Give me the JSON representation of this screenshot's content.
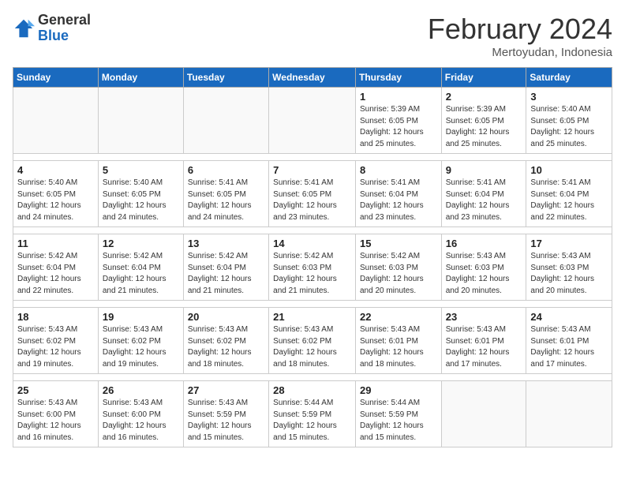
{
  "logo": {
    "general": "General",
    "blue": "Blue"
  },
  "title": "February 2024",
  "subtitle": "Mertoyudan, Indonesia",
  "weekdays": [
    "Sunday",
    "Monday",
    "Tuesday",
    "Wednesday",
    "Thursday",
    "Friday",
    "Saturday"
  ],
  "weeks": [
    [
      {
        "day": "",
        "detail": ""
      },
      {
        "day": "",
        "detail": ""
      },
      {
        "day": "",
        "detail": ""
      },
      {
        "day": "",
        "detail": ""
      },
      {
        "day": "1",
        "detail": "Sunrise: 5:39 AM\nSunset: 6:05 PM\nDaylight: 12 hours\nand 25 minutes."
      },
      {
        "day": "2",
        "detail": "Sunrise: 5:39 AM\nSunset: 6:05 PM\nDaylight: 12 hours\nand 25 minutes."
      },
      {
        "day": "3",
        "detail": "Sunrise: 5:40 AM\nSunset: 6:05 PM\nDaylight: 12 hours\nand 25 minutes."
      }
    ],
    [
      {
        "day": "4",
        "detail": "Sunrise: 5:40 AM\nSunset: 6:05 PM\nDaylight: 12 hours\nand 24 minutes."
      },
      {
        "day": "5",
        "detail": "Sunrise: 5:40 AM\nSunset: 6:05 PM\nDaylight: 12 hours\nand 24 minutes."
      },
      {
        "day": "6",
        "detail": "Sunrise: 5:41 AM\nSunset: 6:05 PM\nDaylight: 12 hours\nand 24 minutes."
      },
      {
        "day": "7",
        "detail": "Sunrise: 5:41 AM\nSunset: 6:05 PM\nDaylight: 12 hours\nand 23 minutes."
      },
      {
        "day": "8",
        "detail": "Sunrise: 5:41 AM\nSunset: 6:04 PM\nDaylight: 12 hours\nand 23 minutes."
      },
      {
        "day": "9",
        "detail": "Sunrise: 5:41 AM\nSunset: 6:04 PM\nDaylight: 12 hours\nand 23 minutes."
      },
      {
        "day": "10",
        "detail": "Sunrise: 5:41 AM\nSunset: 6:04 PM\nDaylight: 12 hours\nand 22 minutes."
      }
    ],
    [
      {
        "day": "11",
        "detail": "Sunrise: 5:42 AM\nSunset: 6:04 PM\nDaylight: 12 hours\nand 22 minutes."
      },
      {
        "day": "12",
        "detail": "Sunrise: 5:42 AM\nSunset: 6:04 PM\nDaylight: 12 hours\nand 21 minutes."
      },
      {
        "day": "13",
        "detail": "Sunrise: 5:42 AM\nSunset: 6:04 PM\nDaylight: 12 hours\nand 21 minutes."
      },
      {
        "day": "14",
        "detail": "Sunrise: 5:42 AM\nSunset: 6:03 PM\nDaylight: 12 hours\nand 21 minutes."
      },
      {
        "day": "15",
        "detail": "Sunrise: 5:42 AM\nSunset: 6:03 PM\nDaylight: 12 hours\nand 20 minutes."
      },
      {
        "day": "16",
        "detail": "Sunrise: 5:43 AM\nSunset: 6:03 PM\nDaylight: 12 hours\nand 20 minutes."
      },
      {
        "day": "17",
        "detail": "Sunrise: 5:43 AM\nSunset: 6:03 PM\nDaylight: 12 hours\nand 20 minutes."
      }
    ],
    [
      {
        "day": "18",
        "detail": "Sunrise: 5:43 AM\nSunset: 6:02 PM\nDaylight: 12 hours\nand 19 minutes."
      },
      {
        "day": "19",
        "detail": "Sunrise: 5:43 AM\nSunset: 6:02 PM\nDaylight: 12 hours\nand 19 minutes."
      },
      {
        "day": "20",
        "detail": "Sunrise: 5:43 AM\nSunset: 6:02 PM\nDaylight: 12 hours\nand 18 minutes."
      },
      {
        "day": "21",
        "detail": "Sunrise: 5:43 AM\nSunset: 6:02 PM\nDaylight: 12 hours\nand 18 minutes."
      },
      {
        "day": "22",
        "detail": "Sunrise: 5:43 AM\nSunset: 6:01 PM\nDaylight: 12 hours\nand 18 minutes."
      },
      {
        "day": "23",
        "detail": "Sunrise: 5:43 AM\nSunset: 6:01 PM\nDaylight: 12 hours\nand 17 minutes."
      },
      {
        "day": "24",
        "detail": "Sunrise: 5:43 AM\nSunset: 6:01 PM\nDaylight: 12 hours\nand 17 minutes."
      }
    ],
    [
      {
        "day": "25",
        "detail": "Sunrise: 5:43 AM\nSunset: 6:00 PM\nDaylight: 12 hours\nand 16 minutes."
      },
      {
        "day": "26",
        "detail": "Sunrise: 5:43 AM\nSunset: 6:00 PM\nDaylight: 12 hours\nand 16 minutes."
      },
      {
        "day": "27",
        "detail": "Sunrise: 5:43 AM\nSunset: 5:59 PM\nDaylight: 12 hours\nand 15 minutes."
      },
      {
        "day": "28",
        "detail": "Sunrise: 5:44 AM\nSunset: 5:59 PM\nDaylight: 12 hours\nand 15 minutes."
      },
      {
        "day": "29",
        "detail": "Sunrise: 5:44 AM\nSunset: 5:59 PM\nDaylight: 12 hours\nand 15 minutes."
      },
      {
        "day": "",
        "detail": ""
      },
      {
        "day": "",
        "detail": ""
      }
    ]
  ]
}
